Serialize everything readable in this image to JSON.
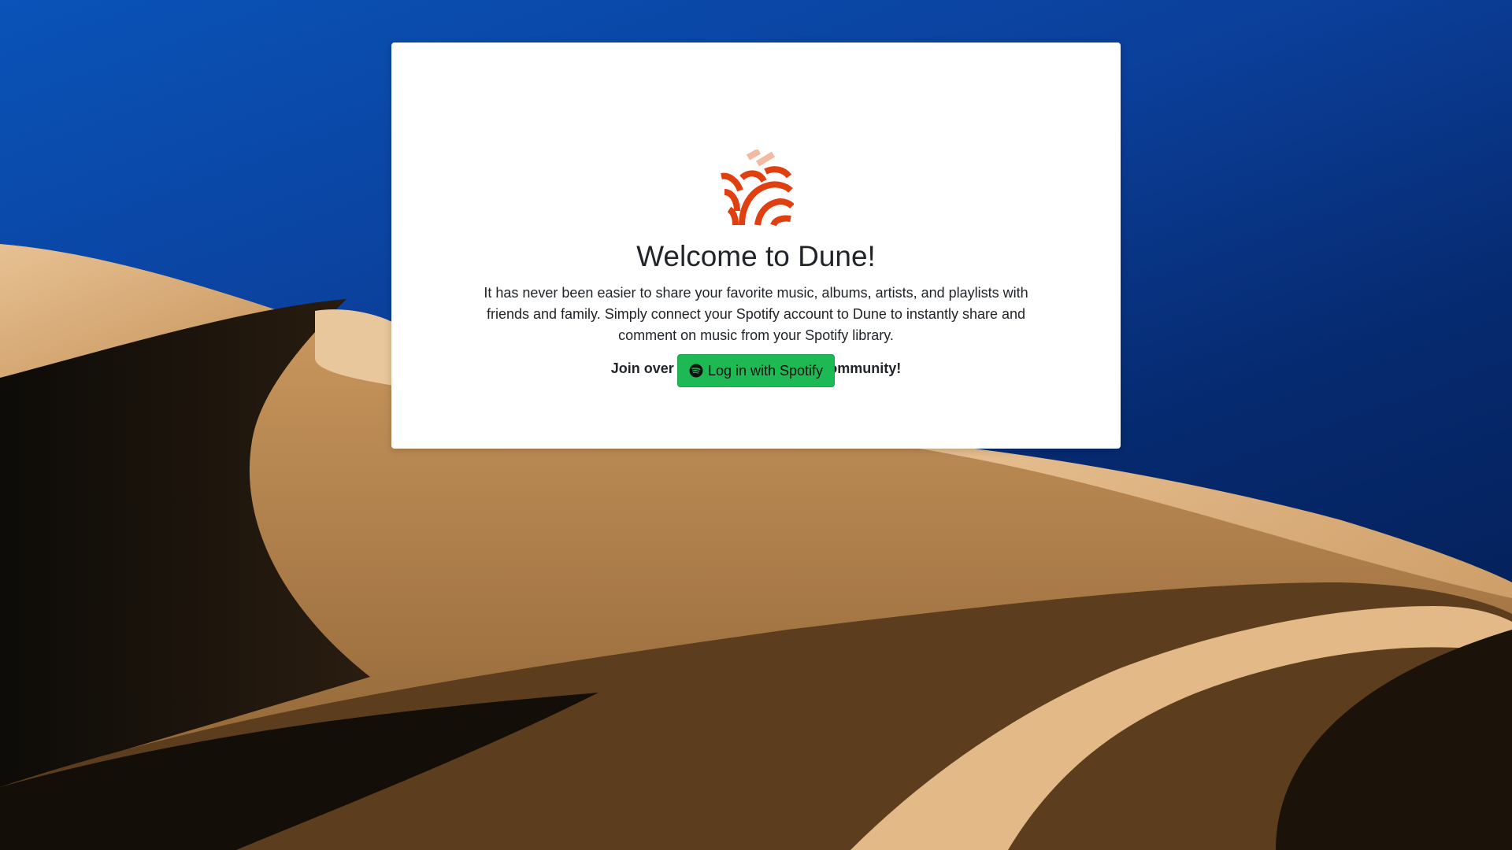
{
  "app": {
    "name": "Dune",
    "brand_color": "#e0400f",
    "brand_light_color": "#f4b9a3",
    "logo_icon": "dune-logo-icon"
  },
  "welcome": {
    "title": "Welcome to Dune!",
    "description": "It has never been easier to share your favorite music, albums, artists, and playlists with friends and family. Simply connect your Spotify account to Dune to instantly share and comment on music from your Spotify library.",
    "community_text": "Join over 5+ users in the Dune community!"
  },
  "login": {
    "button_label": "Log in with Spotify",
    "button_icon": "spotify-icon",
    "button_color": "#1db954"
  },
  "background": {
    "description_icon": "desert-dunes-background",
    "sky_color": "#0a4aa8",
    "sand_color": "#c8955c"
  }
}
